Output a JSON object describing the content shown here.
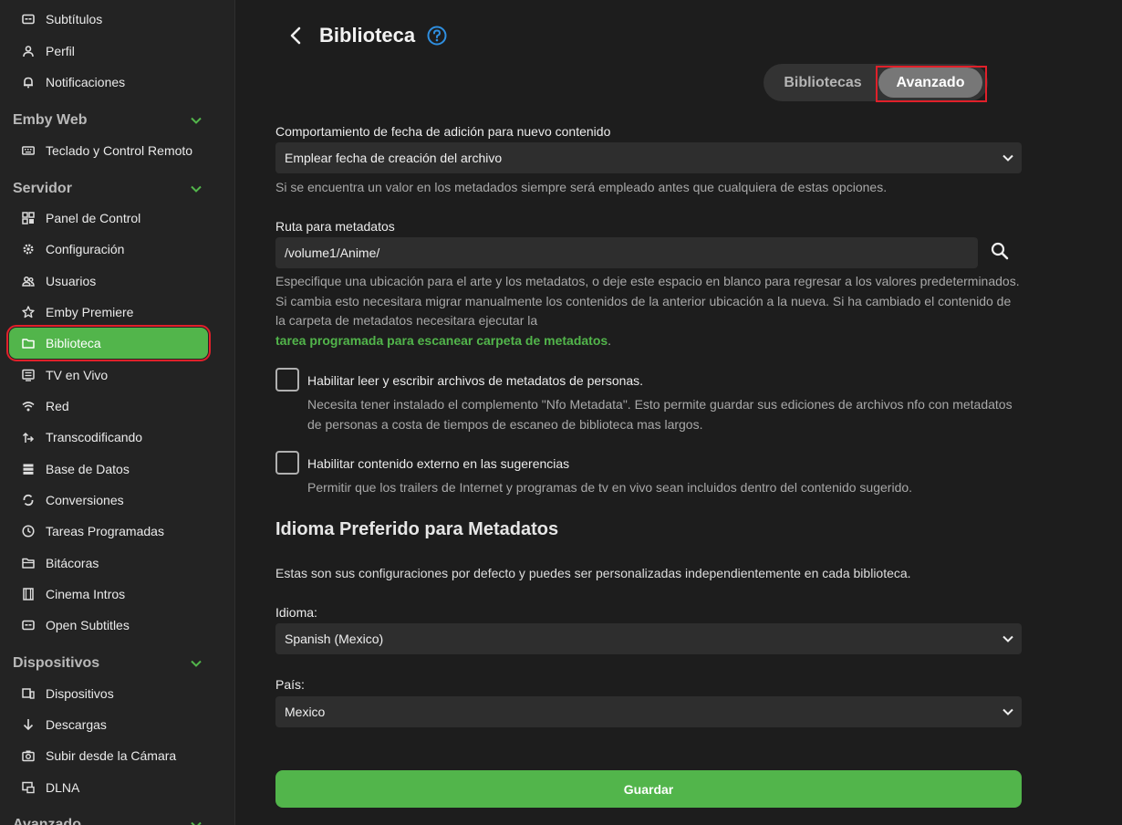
{
  "sidebar": {
    "items_top": [
      {
        "label": "Subtítulos",
        "icon": "subtitles-icon"
      },
      {
        "label": "Perfil",
        "icon": "person-icon"
      },
      {
        "label": "Notificaciones",
        "icon": "bell-icon"
      }
    ],
    "section_web": "Emby Web",
    "items_web": [
      {
        "label": "Teclado y Control Remoto",
        "icon": "keyboard-icon"
      }
    ],
    "section_server": "Servidor",
    "items_server": [
      {
        "label": "Panel de Control",
        "icon": "dashboard-icon"
      },
      {
        "label": "Configuración",
        "icon": "gear-icon"
      },
      {
        "label": "Usuarios",
        "icon": "users-icon"
      },
      {
        "label": "Emby Premiere",
        "icon": "star-icon"
      },
      {
        "label": "Biblioteca",
        "icon": "folder-icon"
      },
      {
        "label": "TV en Vivo",
        "icon": "tv-guide-icon"
      },
      {
        "label": "Red",
        "icon": "wifi-icon"
      },
      {
        "label": "Transcodificando",
        "icon": "transcode-icon"
      },
      {
        "label": "Base de Datos",
        "icon": "database-icon"
      },
      {
        "label": "Conversiones",
        "icon": "sync-icon"
      },
      {
        "label": "Tareas Programadas",
        "icon": "clock-icon"
      },
      {
        "label": "Bitácoras",
        "icon": "folder-open-icon"
      },
      {
        "label": "Cinema Intros",
        "icon": "film-icon"
      },
      {
        "label": "Open Subtitles",
        "icon": "subtitles-icon"
      }
    ],
    "section_devices": "Dispositivos",
    "items_devices": [
      {
        "label": "Dispositivos",
        "icon": "devices-icon"
      },
      {
        "label": "Descargas",
        "icon": "download-icon"
      },
      {
        "label": "Subir desde la Cámara",
        "icon": "camera-icon"
      },
      {
        "label": "DLNA",
        "icon": "dlna-icon"
      }
    ],
    "section_advanced": "Avanzado"
  },
  "header": {
    "title": "Biblioteca"
  },
  "tabs": {
    "libraries": "Bibliotecas",
    "advanced": "Avanzado"
  },
  "form": {
    "date_added_label": "Comportamiento de fecha de adición para nuevo contenido",
    "date_added_value": "Emplear fecha de creación del archivo",
    "date_added_help": "Si se encuentra un valor en los metadados siempre será empleado antes que cualquiera de estas opciones.",
    "metadata_path_label": "Ruta para metadatos",
    "metadata_path_value": "/volume1/Anime/",
    "metadata_path_help": "Especifique una ubicación para el arte y los metadatos, o deje este espacio en blanco para regresar a los valores predeterminados. Si cambia esto necesitara migrar manualmente los contenidos de la anterior ubicación a la nueva. Si ha cambiado el contenido de la carpeta de metadatos necesitara ejecutar la",
    "metadata_path_link": "tarea programada para escanear carpeta de metadatos",
    "people_nfo_label": "Habilitar leer y escribir archivos de metadatos de personas.",
    "people_nfo_help": "Necesita tener instalado el complemento \"Nfo Metadata\". Esto permite guardar sus ediciones de archivos nfo con metadatos de personas a costa de tiempos de escaneo de biblioteca mas largos.",
    "external_content_label": "Habilitar contenido externo en las sugerencias",
    "external_content_help": "Permitir que los trailers de Internet y programas de tv en vivo sean incluidos dentro del contenido sugerido.",
    "lang_section_title": "Idioma Preferido para Metadatos",
    "lang_section_desc": "Estas son sus configuraciones por defecto y puedes ser personalizadas independientemente en cada biblioteca.",
    "language_label": "Idioma:",
    "language_value": "Spanish (Mexico)",
    "country_label": "País:",
    "country_value": "Mexico",
    "save_label": "Guardar"
  },
  "colors": {
    "accent": "#52b54b",
    "highlight": "#e0202a",
    "help_icon": "#2f8fe0"
  }
}
